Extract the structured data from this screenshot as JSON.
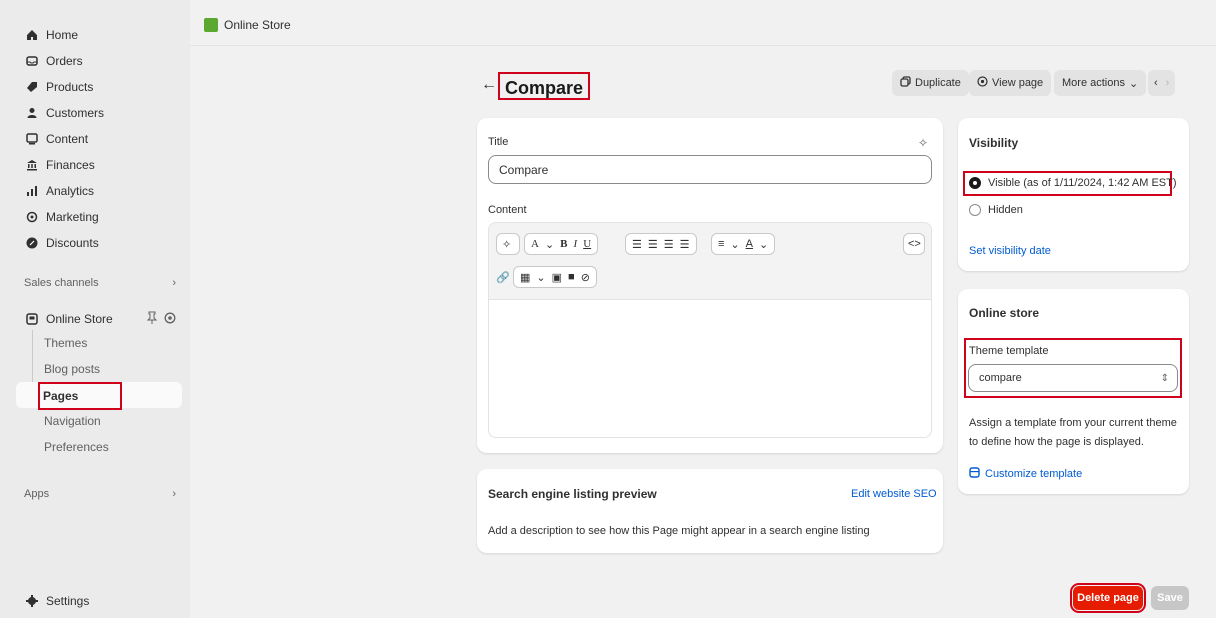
{
  "sidebar": {
    "items": [
      {
        "label": "Home",
        "icon": "home-icon"
      },
      {
        "label": "Orders",
        "icon": "orders-icon"
      },
      {
        "label": "Products",
        "icon": "products-icon"
      },
      {
        "label": "Customers",
        "icon": "customers-icon"
      },
      {
        "label": "Content",
        "icon": "content-icon"
      },
      {
        "label": "Finances",
        "icon": "finances-icon"
      },
      {
        "label": "Analytics",
        "icon": "analytics-icon"
      },
      {
        "label": "Marketing",
        "icon": "marketing-icon"
      },
      {
        "label": "Discounts",
        "icon": "discounts-icon"
      }
    ],
    "sales_channels_label": "Sales channels",
    "online_store_label": "Online Store",
    "sub_items": [
      {
        "label": "Themes"
      },
      {
        "label": "Blog posts"
      },
      {
        "label": "Pages"
      },
      {
        "label": "Navigation"
      },
      {
        "label": "Preferences"
      }
    ],
    "apps_label": "Apps",
    "settings_label": "Settings"
  },
  "topbar": {
    "store_name": "Online Store"
  },
  "header": {
    "back_arrow": "←",
    "title": "Compare",
    "duplicate_label": "Duplicate",
    "view_page_label": "View page",
    "more_actions_label": "More actions"
  },
  "editor": {
    "title_label": "Title",
    "title_value": "Compare",
    "content_label": "Content"
  },
  "seo": {
    "heading": "Search engine listing preview",
    "edit_link": "Edit website SEO",
    "description": "Add a description to see how this Page might appear in a search engine listing"
  },
  "visibility": {
    "heading": "Visibility",
    "visible_label": "Visible (as of 1/11/2024, 1:42 AM EST)",
    "hidden_label": "Hidden",
    "set_date_link": "Set visibility date"
  },
  "online_store": {
    "heading": "Online store",
    "theme_template_label": "Theme template",
    "theme_template_value": "compare",
    "help_text": "Assign a template from your current theme to define how the page is displayed.",
    "customize_link": "Customize template"
  },
  "footer": {
    "delete_label": "Delete page",
    "save_label": "Save"
  },
  "colors": {
    "accent_link": "#005bd3",
    "danger": "#e51c00",
    "highlight": "#d0021b"
  }
}
